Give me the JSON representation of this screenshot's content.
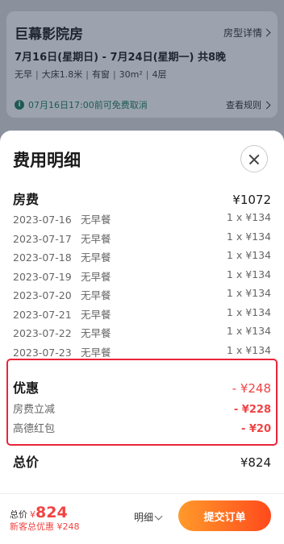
{
  "booking": {
    "hotel_title": "巨幕影院房",
    "room_detail_link": "房型详情",
    "dates": "7月16日(星期日) - 7月24日(星期一)  共8晚",
    "tags": [
      "无早",
      "大床1.8米",
      "有窗",
      "30m²",
      "4层"
    ],
    "cancel_note": "07月16日17:00前可免费取消",
    "rules_link": "查看规则"
  },
  "sheet": {
    "title": "费用明细",
    "room_fee": {
      "label": "房费",
      "value": "¥1072"
    },
    "nights": [
      {
        "date": "2023-07-16",
        "meal": "无早餐",
        "price": "1 x ¥134"
      },
      {
        "date": "2023-07-17",
        "meal": "无早餐",
        "price": "1 x ¥134"
      },
      {
        "date": "2023-07-18",
        "meal": "无早餐",
        "price": "1 x ¥134"
      },
      {
        "date": "2023-07-19",
        "meal": "无早餐",
        "price": "1 x ¥134"
      },
      {
        "date": "2023-07-20",
        "meal": "无早餐",
        "price": "1 x ¥134"
      },
      {
        "date": "2023-07-21",
        "meal": "无早餐",
        "price": "1 x ¥134"
      },
      {
        "date": "2023-07-22",
        "meal": "无早餐",
        "price": "1 x ¥134"
      },
      {
        "date": "2023-07-23",
        "meal": "无早餐",
        "price": "1 x ¥134"
      }
    ],
    "discount": {
      "label": "优惠",
      "value": "- ¥248",
      "items": [
        {
          "label": "房费立减",
          "value": "- ¥228"
        },
        {
          "label": "高德红包",
          "value": "- ¥20"
        }
      ]
    },
    "total": {
      "label": "总价",
      "value": "¥824"
    }
  },
  "bottom_bar": {
    "total_label": "总价",
    "currency": "¥",
    "amount": "824",
    "promo": "新客总优惠 ¥248",
    "detail_label": "明细",
    "submit_label": "提交订单"
  },
  "colors": {
    "accent_red": "#f04444",
    "button_orange": "#ff7a22",
    "highlight_border": "#e8253a"
  }
}
